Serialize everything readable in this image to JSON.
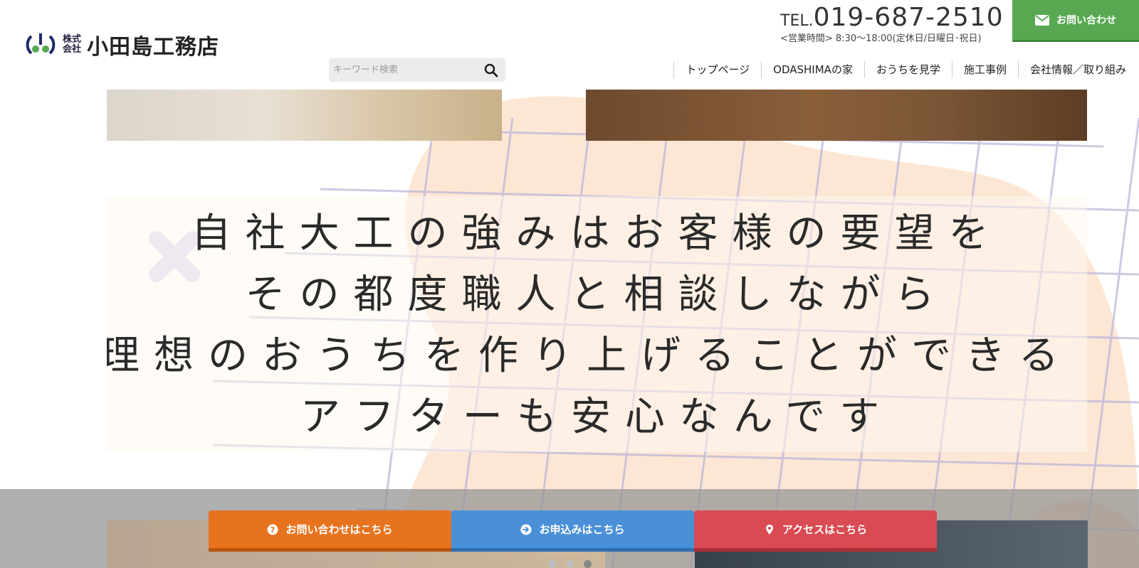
{
  "header": {
    "logo": {
      "small_text": "株式会社",
      "name": "小田島工務店"
    },
    "search": {
      "placeholder": "キーワード検索"
    },
    "tel": {
      "prefix": "TEL.",
      "number": "019-687-2510",
      "hours": "<営業時間> 8:30〜18:00(定休日/日曜日･祝日)"
    },
    "contact_button": {
      "label": "お問い合わせ",
      "icon": "envelope-icon",
      "color": "#58a851"
    },
    "nav": [
      {
        "label": "トップページ"
      },
      {
        "label": "ODASHIMAの家"
      },
      {
        "label": "おうちを見学"
      },
      {
        "label": "施工事例"
      },
      {
        "label": "会社情報／取り組み"
      }
    ]
  },
  "hero": {
    "lines": [
      "自社大工の強みはお客様の要望を",
      "その都度職人と相談しながら",
      "理想のおうちを作り上げることができる",
      "アフターも安心なんです"
    ],
    "slides_count": 3,
    "active_slide": 3
  },
  "cta": [
    {
      "label": "お問い合わせはこちら",
      "icon": "question-circle-icon",
      "color": "#e8731e"
    },
    {
      "label": "お申込みはこちら",
      "icon": "arrow-circle-right-icon",
      "color": "#4a90d9"
    },
    {
      "label": "アクセスはこちら",
      "icon": "map-pin-icon",
      "color": "#d94a52"
    }
  ]
}
